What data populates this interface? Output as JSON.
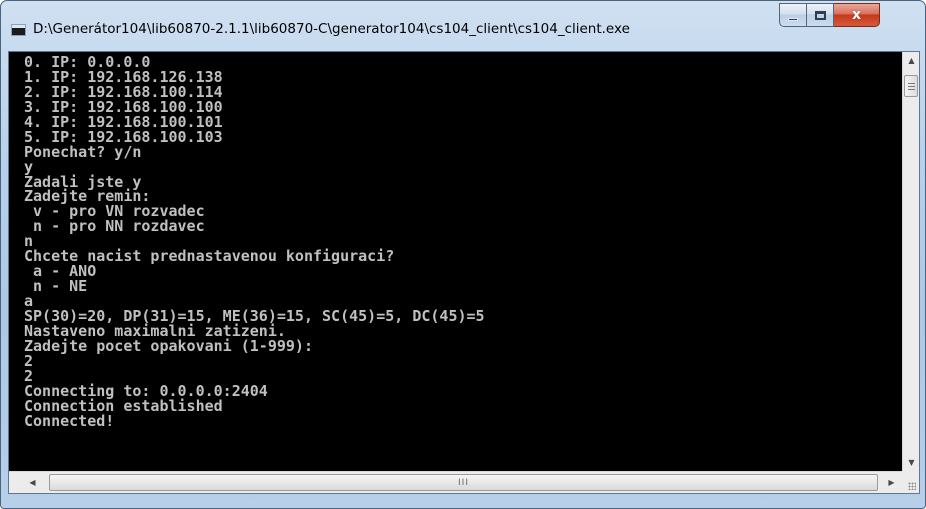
{
  "window": {
    "title": "D:\\Generátor104\\lib60870-2.1.1\\lib60870-C\\generator104\\cs104_client\\cs104_client.exe",
    "buttons": {
      "minimize": "minimize",
      "maximize": "maximize",
      "close": "x"
    }
  },
  "console": {
    "lines": [
      "0. IP: 0.0.0.0",
      "1. IP: 192.168.126.138",
      "2. IP: 192.168.100.114",
      "3. IP: 192.168.100.100",
      "4. IP: 192.168.100.101",
      "5. IP: 192.168.100.103",
      "Ponechat? y/n",
      "y",
      "Zadali jste y",
      "Zadejte remin:",
      " v - pro VN rozvadec",
      " n - pro NN rozdavec",
      "n",
      "Chcete nacist prednastavenou konfiguraci?",
      " a - ANO",
      " n - NE",
      "a",
      "SP(30)=20, DP(31)=15, ME(36)=15, SC(45)=5, DC(45)=5",
      "Nastaveno maximalni zatizeni.",
      "Zadejte pocet opakovani (1-999):",
      "2",
      "2",
      "Connecting to: 0.0.0.0:2404",
      "Connection established",
      "Connected!"
    ]
  },
  "scrollbars": {
    "horizontal_grip": "III"
  },
  "colors": {
    "console_bg": "#000000",
    "console_text": "#c0c0c0",
    "close_button": "#c4391b"
  }
}
